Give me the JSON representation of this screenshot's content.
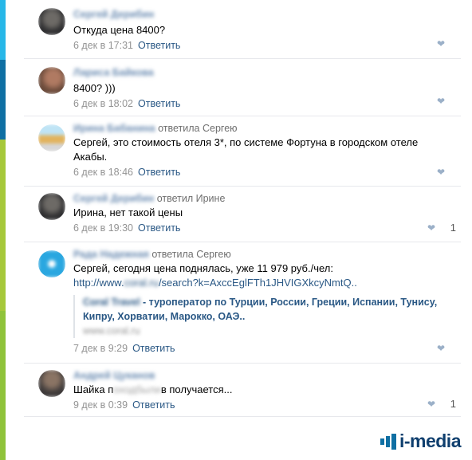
{
  "brand": {
    "name": "i-media",
    "color": "#0f6fa3"
  },
  "like_icon": "heart-icon",
  "reply_label": "Ответить",
  "comments": [
    {
      "author": "Сергей Дерибин",
      "reply_to": "",
      "text": "Откуда цена 8400?",
      "date": "6 дек в 17:31",
      "likes": ""
    },
    {
      "author": "Лариса Байкова",
      "reply_to": "",
      "text": "8400? )))",
      "date": "6 дек в 18:02",
      "likes": ""
    },
    {
      "author": "Ирина Бабанина",
      "reply_to": "ответила Сергею",
      "text": "Сергей, это стоимость отеля 3*, по системе Фортуна в городском отеле Акабы.",
      "date": "6 дек в 18:46",
      "likes": ""
    },
    {
      "author": "Сергей Дерибин",
      "reply_to": "ответил Ирине",
      "text": "Ирина, нет такой цены",
      "date": "6 дек в 19:30",
      "likes": "1"
    },
    {
      "author": "Рада Надежная",
      "reply_to": "ответила Сергею",
      "text": "Сергей, сегодня цена поднялась, уже 11 979 руб./чел:",
      "link_prefix": "http://www.",
      "link_domain": "coral.ru",
      "link_rest": "/search?k=AxccEglFTh1JHVIGXkcyNmtQ..",
      "card_name": "Coral Travel",
      "card_title": " - туроператор по Турции, России, Греции, Испании, Тунису, Кипру, Хорватии, Марокко, ОАЭ..",
      "card_site": "www.coral.ru",
      "date": "7 дек в 9:29",
      "likes": ""
    },
    {
      "author": "Андрей Цуканов",
      "reply_to": "",
      "text_a": "Шайка п",
      "text_hidden": "оходбыли",
      "text_b": "в получается...",
      "date": "9 дек в 0:39",
      "likes": "1"
    }
  ]
}
